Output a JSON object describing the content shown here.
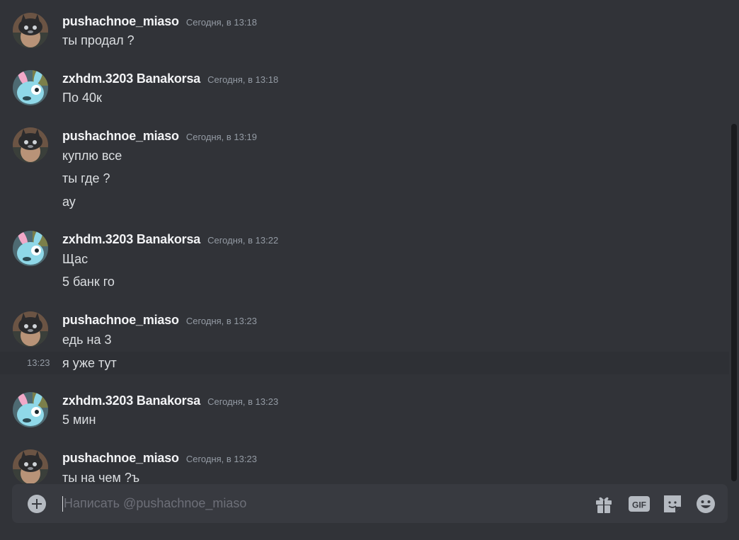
{
  "messages": [
    {
      "author": "pushachnoe_miaso",
      "avatar": "dark-cat-avatar",
      "timestamp": "Сегодня, в 13:18",
      "lines": [
        "ты продал ?"
      ]
    },
    {
      "author": "zxhdm.3203 Banakorsa",
      "avatar": "blue-rabbit-avatar",
      "timestamp": "Сегодня, в 13:18",
      "lines": [
        "По 40к"
      ]
    },
    {
      "author": "pushachnoe_miaso",
      "avatar": "dark-cat-avatar",
      "timestamp": "Сегодня, в 13:19",
      "lines": [
        "куплю все",
        "ты где ?",
        "ау"
      ]
    },
    {
      "author": "zxhdm.3203 Banakorsa",
      "avatar": "blue-rabbit-avatar",
      "timestamp": "Сегодня, в 13:22",
      "lines": [
        "Щас",
        "5 банк го"
      ]
    },
    {
      "author": "pushachnoe_miaso",
      "avatar": "dark-cat-avatar",
      "timestamp": "Сегодня, в 13:23",
      "lines": [
        "едь на 3",
        "я уже тут"
      ]
    },
    {
      "author": "zxhdm.3203 Banakorsa",
      "avatar": "blue-rabbit-avatar",
      "timestamp": "Сегодня, в 13:23",
      "lines": [
        "5 мин"
      ]
    },
    {
      "author": "pushachnoe_miaso",
      "avatar": "dark-cat-avatar",
      "timestamp": "Сегодня, в 13:23",
      "lines": [
        "ты на чем ?ъ"
      ]
    }
  ],
  "hover_time": "13:23",
  "composer": {
    "placeholder": "Написать @pushachnoe_miaso",
    "value": "",
    "gif_label": "GIF",
    "icons": [
      "add-icon",
      "gift-icon",
      "gif-icon",
      "sticker-icon",
      "emoji-icon"
    ]
  },
  "colors": {
    "background": "#313338",
    "composer": "#383a40",
    "username": "#f2f3f5",
    "text": "#dbdee1",
    "muted": "#949ba4"
  }
}
